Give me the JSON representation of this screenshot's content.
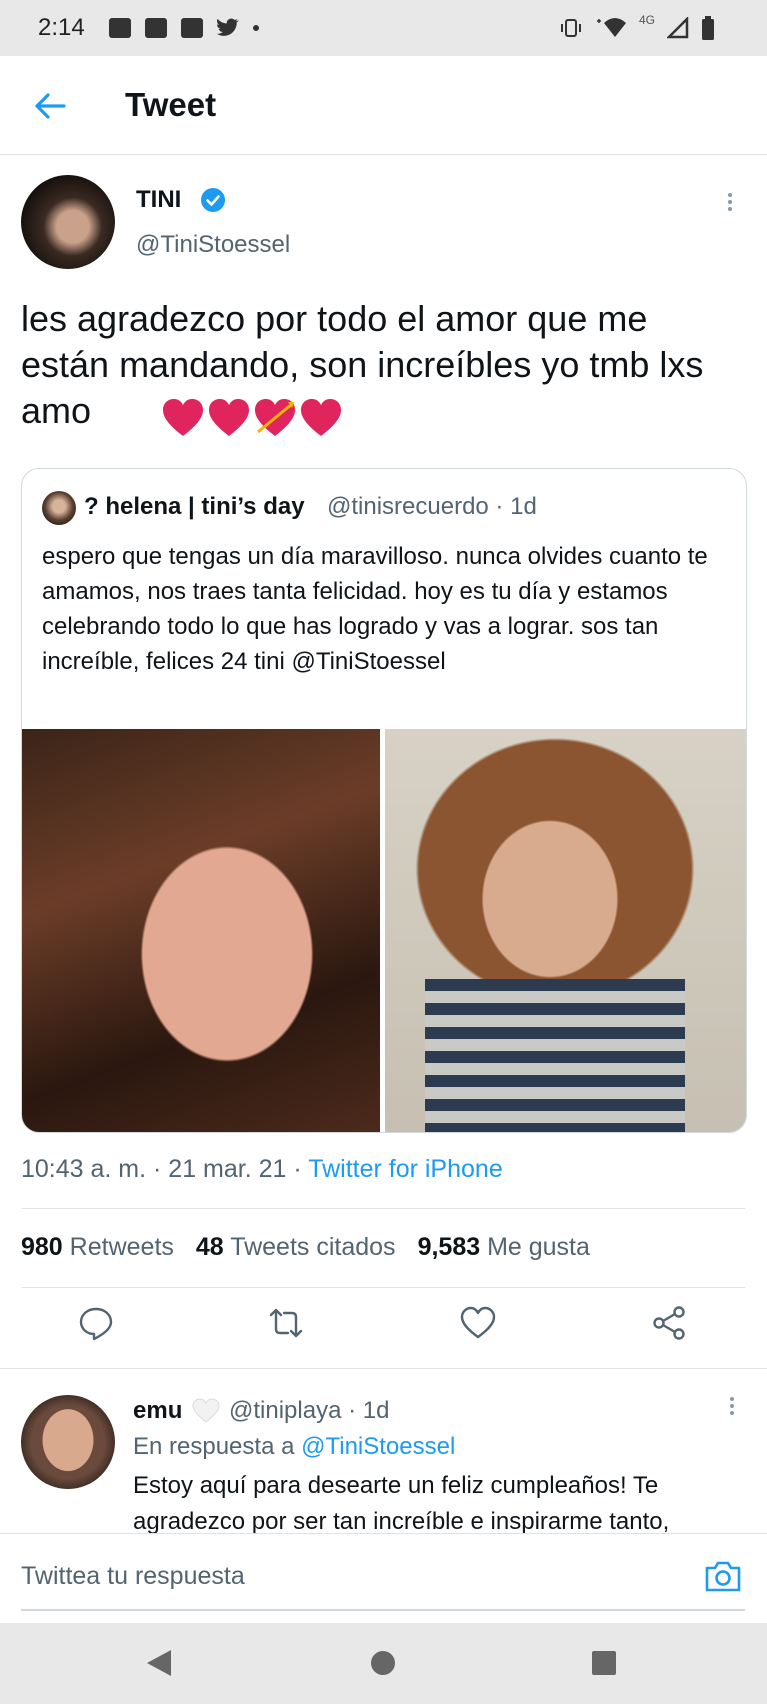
{
  "status_bar": {
    "time": "2:14",
    "network": "4G"
  },
  "header": {
    "title": "Tweet"
  },
  "tweet": {
    "author_name": "TINI",
    "author_handle": "@TiniStoessel",
    "text": "les agradezco por todo el amor que me están mandando, son increíbles yo tmb lxs amo",
    "emojis": [
      "red-heart",
      "red-heart",
      "heart-with-arrow",
      "red-heart"
    ],
    "timestamp": "10:43 a. m. · 21 mar. 21 · ",
    "source": "Twitter for iPhone"
  },
  "quoted_tweet": {
    "author_name": "? helena | tini’s day",
    "author_handle": "@tinisrecuerdo · 1d",
    "text": "espero que tengas un día maravilloso. nunca olvides cuanto te amamos, nos traes tanta felicidad. hoy es tu día y estamos celebrando todo lo que has logrado y vas a lograr. sos tan increíble, felices 24 tini @TiniStoessel"
  },
  "stats": {
    "retweets_count": "980",
    "retweets_label": "Retweets",
    "quotes_count": "48",
    "quotes_label": "Tweets citados",
    "likes_count": "9,583",
    "likes_label": "Me gusta"
  },
  "reply": {
    "author_name": "emu",
    "author_handle": "@tiniplaya · 1d",
    "replying_prefix": "En respuesta a ",
    "replying_to": "@TiniStoessel",
    "text": "Estoy aquí para desearte un feliz cumpleaños! Te agradezco por ser tan increíble e inspirarme tanto,"
  },
  "reply_bar": {
    "placeholder": "Twittea tu respuesta"
  },
  "colors": {
    "accent": "#1d9bf0",
    "heart": "#e0245e",
    "secondary_text": "#536471"
  }
}
